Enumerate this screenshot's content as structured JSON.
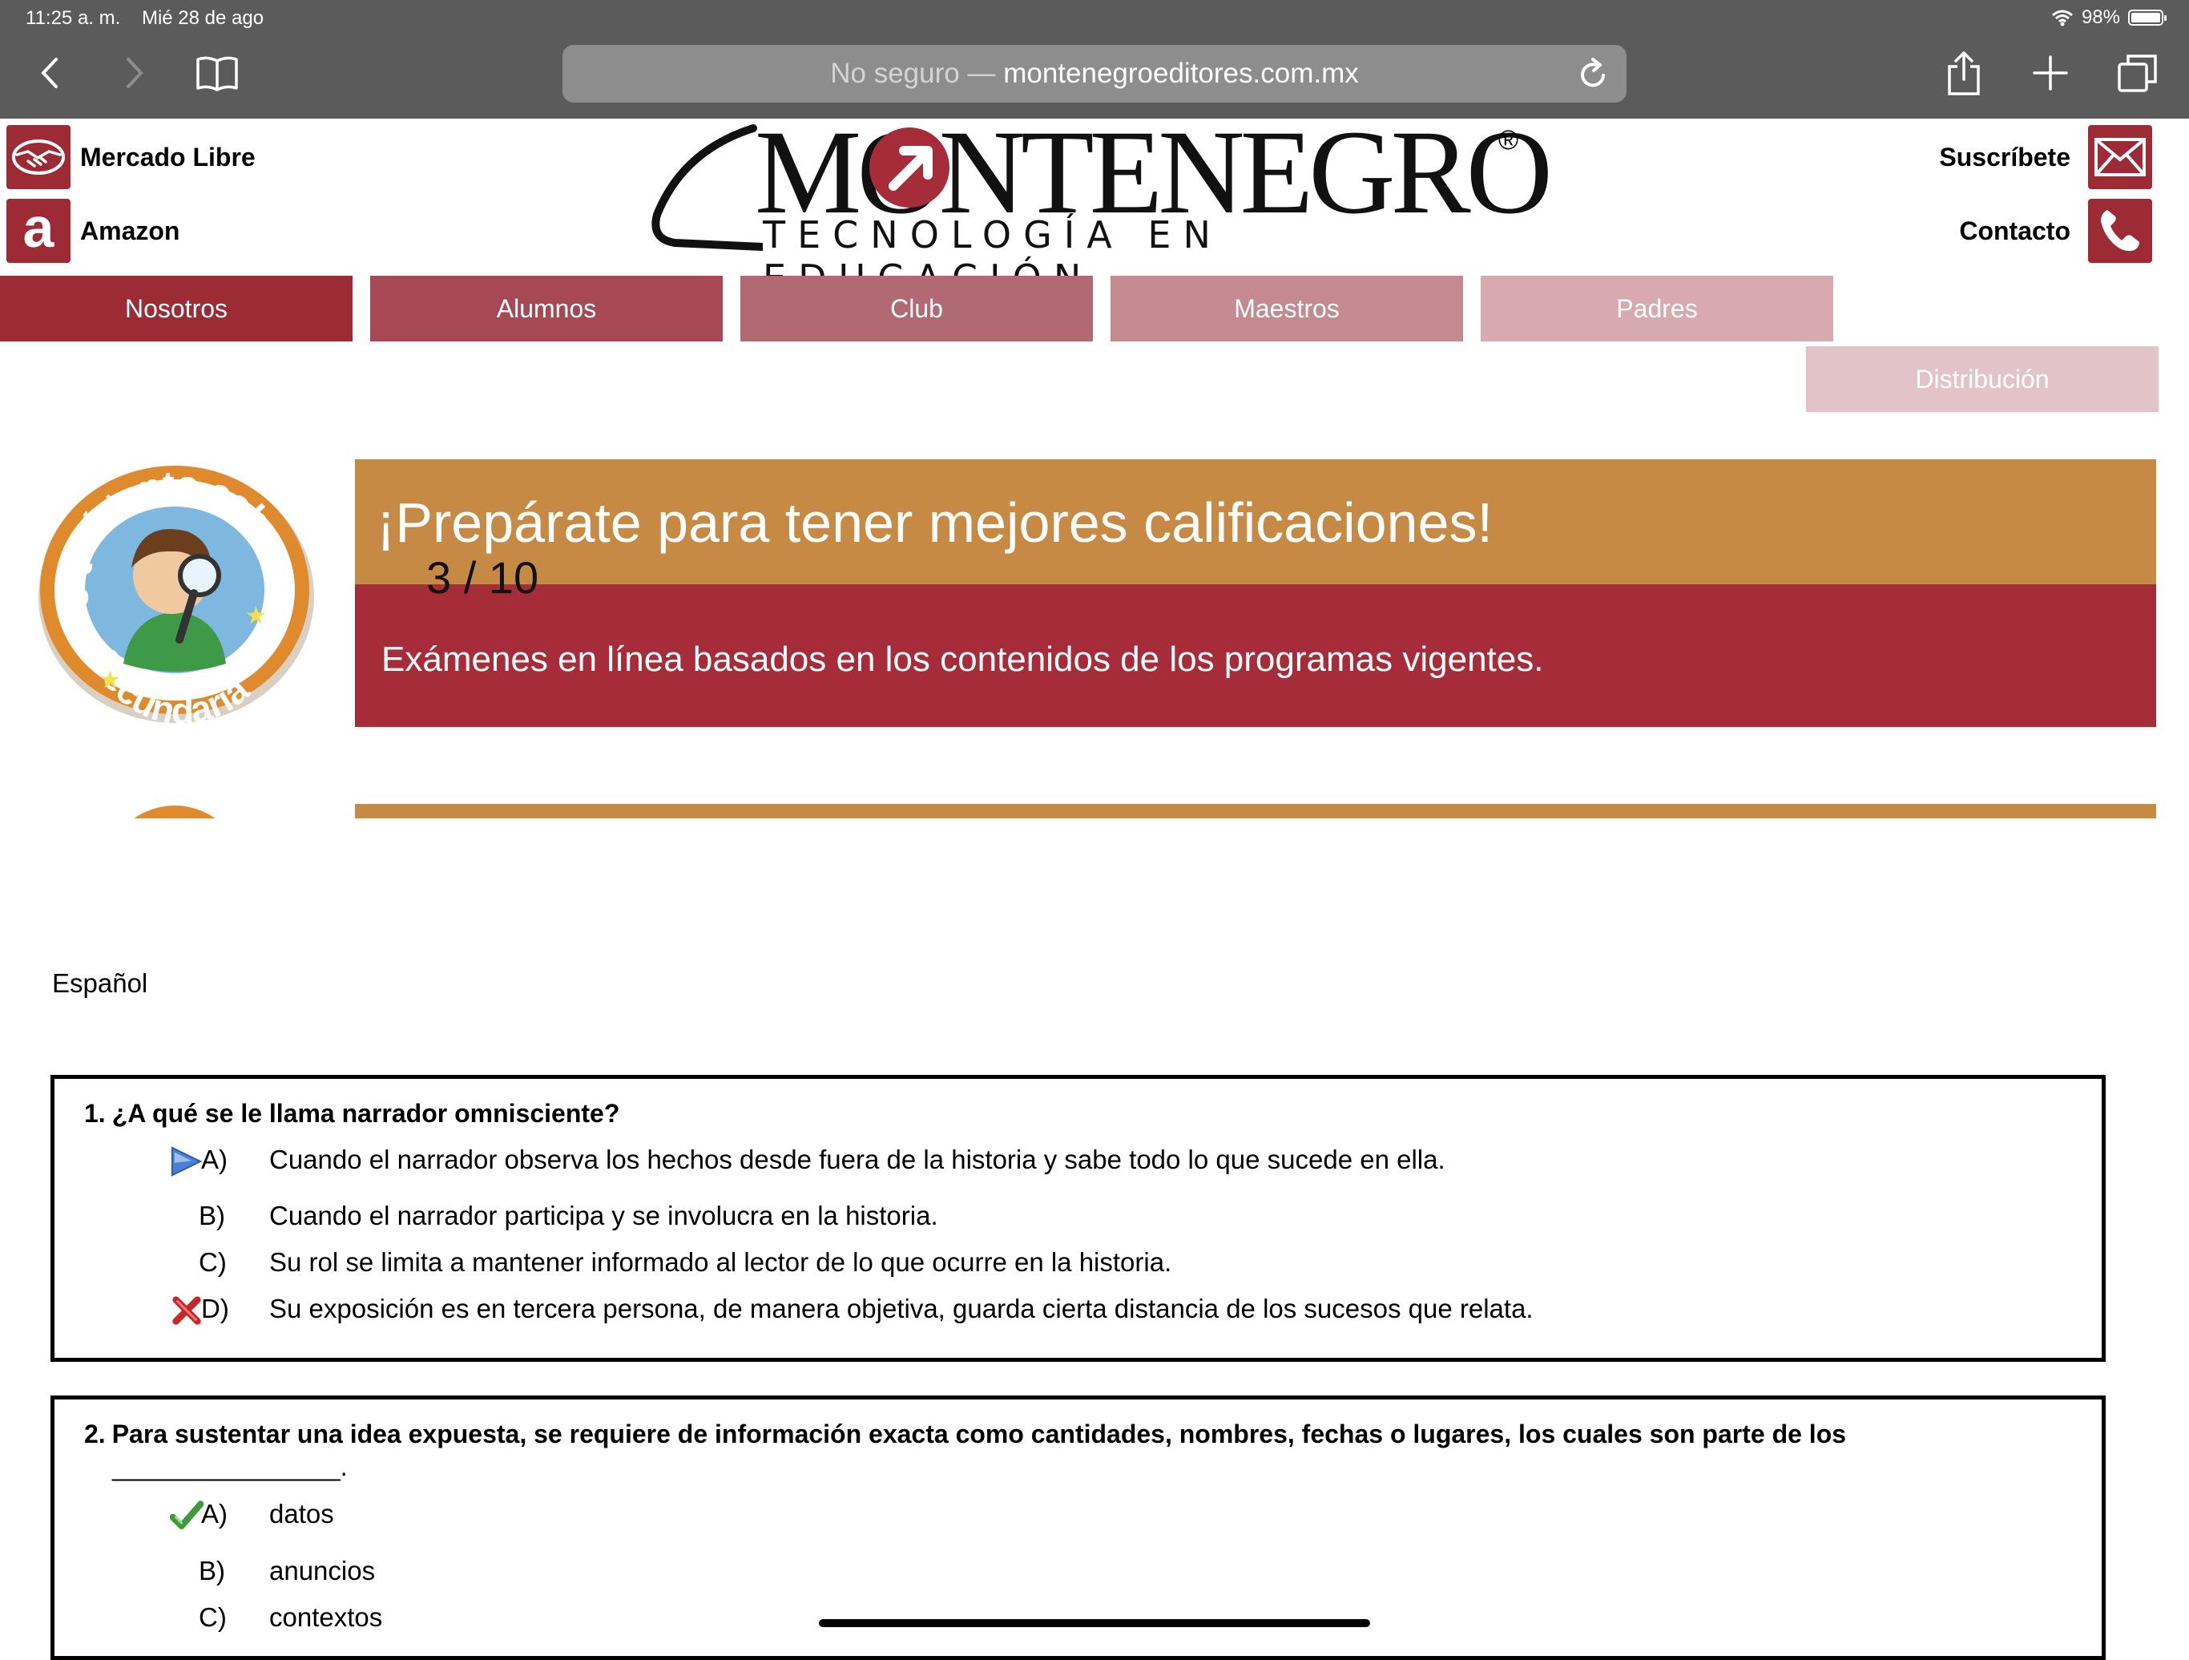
{
  "status_bar": {
    "time": "11:25 a. m.",
    "date": "Mié 28 de ago",
    "battery": "98%",
    "battery_level": 0.98
  },
  "browser": {
    "url_prefix": "No seguro —",
    "url": "montenegroeditores.com.mx"
  },
  "header": {
    "shops": [
      {
        "label": "Mercado Libre",
        "icon": "handshake-icon"
      },
      {
        "label": "Amazon",
        "icon": "amazon-icon",
        "glyph": "a"
      }
    ],
    "logo": {
      "brand": "MONTENEGRO",
      "tagline": "TECNOLOGÍA EN EDUCACIÓN",
      "registered": "®"
    },
    "contact": [
      {
        "label": "Suscríbete",
        "icon": "envelope-icon"
      },
      {
        "label": "Contacto",
        "icon": "phone-icon"
      }
    ]
  },
  "menu": [
    {
      "label": "Nosotros",
      "color": "#9c2b35"
    },
    {
      "label": "Alumnos",
      "color": "#a64954"
    },
    {
      "label": "Club",
      "color": "#b16a72"
    },
    {
      "label": "Maestros",
      "color": "#c48a90"
    },
    {
      "label": "Padres",
      "color": "#d7aab0"
    },
    {
      "label": "Distribución",
      "color": "#e2c4c8"
    }
  ],
  "banner": {
    "badge_top": "¿Qué tanto sabes?",
    "badge_bottom": "Secundaria",
    "title": "¡Prepárate para tener mejores calificaciones!",
    "subtitle": "Exámenes en línea basados en los contenidos de los programas vigentes.",
    "slide_counter": "3 / 10",
    "colors": {
      "orange": "#c78a44",
      "red": "#a72c39"
    }
  },
  "quiz": {
    "subject": "Español",
    "questions": [
      {
        "number": "1.",
        "text": "¿A qué se le llama narrador omnisciente?",
        "options": [
          {
            "letter": "A)",
            "text": "Cuando el narrador observa los hechos desde fuera de la historia y sabe todo lo que sucede en ella.",
            "marker": "arrow-icon"
          },
          {
            "letter": "B)",
            "text": "Cuando el narrador participa y se involucra en la historia.",
            "marker": ""
          },
          {
            "letter": "C)",
            "text": "Su rol se limita a mantener informado al lector de lo que ocurre en la historia.",
            "marker": ""
          },
          {
            "letter": "D)",
            "text": "Su exposición es en tercera persona, de manera objetiva, guarda cierta distancia de los sucesos que relata.",
            "marker": "cross-icon"
          }
        ]
      },
      {
        "number": "2.",
        "text": "Para sustentar una idea expuesta, se requiere de información exacta como cantidades, nombres, fechas o lugares, los cuales son parte de los",
        "blank": "________________.",
        "options": [
          {
            "letter": "A)",
            "text": "datos",
            "marker": "check-icon"
          },
          {
            "letter": "B)",
            "text": "anuncios",
            "marker": ""
          },
          {
            "letter": "C)",
            "text": "contextos",
            "marker": ""
          }
        ]
      }
    ]
  }
}
